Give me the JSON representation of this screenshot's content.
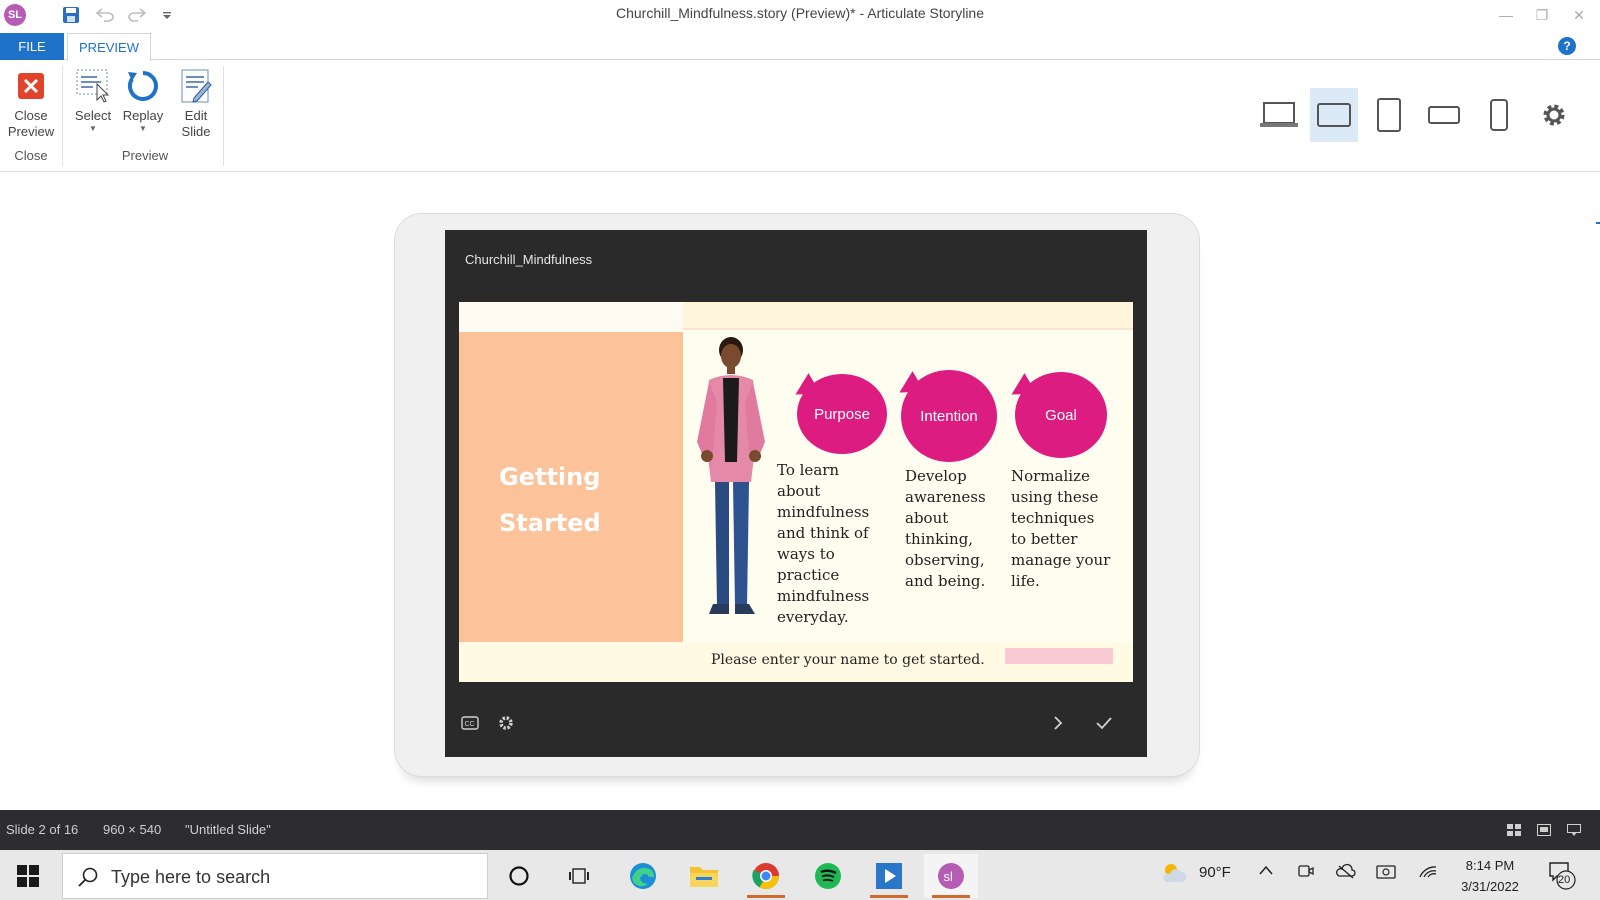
{
  "titlebar": {
    "app_badge": "SL",
    "title": "Churchill_Mindfulness.story (Preview)* -  Articulate Storyline",
    "icons": [
      "save-icon",
      "undo-icon",
      "redo-icon",
      "customize-quick-access-icon",
      "minimize-icon",
      "restore-icon",
      "close-icon"
    ]
  },
  "ribbon_tabs": {
    "file": "FILE",
    "preview": "PREVIEW",
    "help": "?"
  },
  "ribbon": {
    "close_preview_line1": "Close",
    "close_preview_line2": "Preview",
    "close_group": "Close",
    "select": "Select",
    "replay": "Replay",
    "edit_slide_line1": "Edit",
    "edit_slide_line2": "Slide",
    "preview_group": "Preview",
    "devices": [
      "desktop-icon",
      "tablet-landscape-icon",
      "tablet-portrait-icon",
      "phone-landscape-icon",
      "phone-portrait-icon",
      "settings-icon"
    ],
    "active_device": "tablet-landscape-icon"
  },
  "player": {
    "course_title": "Churchill_Mindfulness",
    "slide": {
      "heading_line1": "Getting",
      "heading_line2": "Started",
      "bubbles": [
        {
          "label": "Purpose",
          "text_lines": [
            "To learn",
            "about",
            "mindfulness",
            "and think of",
            "ways to",
            "practice",
            "mindfulness",
            "everyday."
          ]
        },
        {
          "label": "Intention",
          "text_lines": [
            "Develop",
            "awareness",
            "about",
            "thinking,",
            "observing,",
            "and being."
          ]
        },
        {
          "label": "Goal",
          "text_lines": [
            "Normalize",
            "using these",
            "techniques",
            "to better",
            "manage your",
            "life."
          ]
        }
      ],
      "name_prompt": "Please enter your name to get started.",
      "name_value": ""
    },
    "controls": [
      "captions-icon",
      "player-settings-icon",
      "next-icon",
      "submit-check-icon"
    ]
  },
  "statusbar": {
    "slide_position": "Slide 2 of 16",
    "dimensions": "960 × 540",
    "slide_name": "\"Untitled Slide\""
  },
  "taskbar": {
    "search_placeholder": "Type here to search",
    "apps": [
      "cortana-icon",
      "task-view-icon",
      "edge-icon",
      "file-explorer-icon",
      "chrome-icon",
      "spotify-icon",
      "articulate-replay-icon",
      "storyline-icon"
    ],
    "weather": "90°F",
    "time": "8:14 PM",
    "date": "3/31/2022",
    "notifications": "20"
  },
  "colors": {
    "accent": "#1e73c8",
    "bubble": "#dc1c80",
    "panel": "#fcc39a",
    "player_bg": "#2a2a2a"
  }
}
